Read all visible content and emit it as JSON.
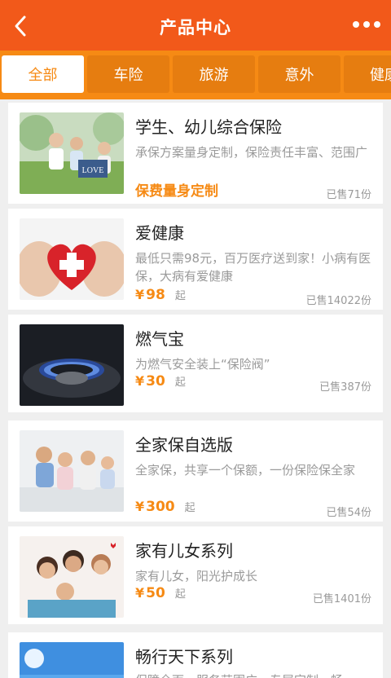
{
  "header": {
    "title": "产品中心",
    "back_icon": "chevron-left-icon",
    "more_icon": "more-horizontal-icon"
  },
  "tabs": [
    {
      "label": "全部",
      "active": true
    },
    {
      "label": "车险"
    },
    {
      "label": "旅游"
    },
    {
      "label": "意外"
    },
    {
      "label": "健康"
    }
  ],
  "colors": {
    "header": "#f2591a",
    "tabbar": "#f68a14",
    "accent": "#f68a14"
  },
  "products": [
    {
      "name": "学生、幼儿综合保险",
      "desc": "承保方案量身定制，保险责任丰富、范围广",
      "slogan": "保费量身定制",
      "sold": "已售71份"
    },
    {
      "name": "爱健康",
      "desc": "最低只需98元，百万医疗送到家！小病有医保，大病有爱健康",
      "currency": "¥",
      "price": "98",
      "qi": "起",
      "sold": "已售14022份"
    },
    {
      "name": "燃气宝",
      "desc": "为燃气安全装上“保险阀”",
      "currency": "¥",
      "price": "30",
      "qi": "起",
      "sold": "已售387份"
    },
    {
      "name": "全家保自选版",
      "desc": "全家保，共享一个保额，一份保险保全家",
      "currency": "¥",
      "price": "300",
      "qi": "起",
      "sold": "已售54份"
    },
    {
      "name": "家有儿女系列",
      "desc": "家有儿女，阳光护成长",
      "currency": "¥",
      "price": "50",
      "qi": "起",
      "sold": "已售1401份"
    },
    {
      "name": "畅行天下系列",
      "desc": "保障全面，服务范围广，专属定制，畅",
      "sold": ""
    }
  ]
}
